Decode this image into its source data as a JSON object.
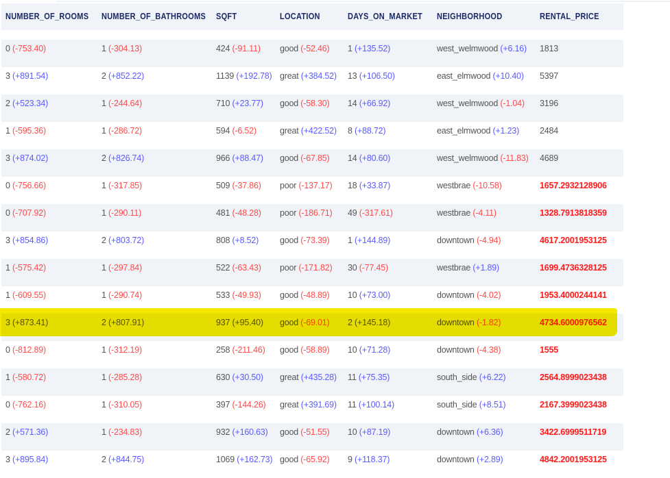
{
  "columns": [
    "NUMBER_OF_ROOMS",
    "NUMBER_OF_BATHROOMS",
    "SQFT",
    "LOCATION",
    "DAYS_ON_MARKET",
    "NEIGHBORHOOD",
    "RENTAL_PRICE"
  ],
  "colors": {
    "negative": "#ff4a4a",
    "positive": "#5b5bff",
    "price_highlight": "#ff1a1a",
    "header": "#1b2a66",
    "row_highlight": "#f5e800"
  },
  "highlighted_row": 10,
  "rows": [
    {
      "cells": [
        [
          "0",
          "(-753.40)"
        ],
        [
          "1",
          "(-304.13)"
        ],
        [
          "424",
          "(-91.11)"
        ],
        [
          "good",
          "(-52.46)"
        ],
        [
          "1",
          "(+135.52)"
        ],
        [
          "west_welmwood",
          "(+6.16)"
        ]
      ],
      "price": "1813",
      "price_bold": false
    },
    {
      "cells": [
        [
          "3",
          "(+891.54)"
        ],
        [
          "2",
          "(+852.22)"
        ],
        [
          "1139",
          "(+192.78)"
        ],
        [
          "great",
          "(+384.52)"
        ],
        [
          "13",
          "(+106.50)"
        ],
        [
          "east_elmwood",
          "(+10.40)"
        ]
      ],
      "price": "5397",
      "price_bold": false
    },
    {
      "cells": [
        [
          "2",
          "(+523.34)"
        ],
        [
          "1",
          "(-244.64)"
        ],
        [
          "710",
          "(+23.77)"
        ],
        [
          "good",
          "(-58.30)"
        ],
        [
          "14",
          "(+66.92)"
        ],
        [
          "west_welmwood",
          "(-1.04)"
        ]
      ],
      "price": "3196",
      "price_bold": false
    },
    {
      "cells": [
        [
          "1",
          "(-595.36)"
        ],
        [
          "1",
          "(-286.72)"
        ],
        [
          "594",
          "(-6.52)"
        ],
        [
          "great",
          "(+422.52)"
        ],
        [
          "8",
          "(+88.72)"
        ],
        [
          "east_elmwood",
          "(+1.23)"
        ]
      ],
      "price": "2484",
      "price_bold": false
    },
    {
      "cells": [
        [
          "3",
          "(+874.02)"
        ],
        [
          "2",
          "(+826.74)"
        ],
        [
          "966",
          "(+88.47)"
        ],
        [
          "good",
          "(-67.85)"
        ],
        [
          "14",
          "(+80.60)"
        ],
        [
          "west_welmwood",
          "(-11.83)"
        ]
      ],
      "price": "4689",
      "price_bold": false
    },
    {
      "cells": [
        [
          "0",
          "(-756.66)"
        ],
        [
          "1",
          "(-317.85)"
        ],
        [
          "509",
          "(-37.86)"
        ],
        [
          "poor",
          "(-137.17)"
        ],
        [
          "18",
          "(+33.87)"
        ],
        [
          "westbrae",
          "(-10.58)"
        ]
      ],
      "price": "1657.2932128906",
      "price_bold": true
    },
    {
      "cells": [
        [
          "0",
          "(-707.92)"
        ],
        [
          "1",
          "(-290.11)"
        ],
        [
          "481",
          "(-48.28)"
        ],
        [
          "poor",
          "(-186.71)"
        ],
        [
          "49",
          "(-317.61)"
        ],
        [
          "westbrae",
          "(-4.11)"
        ]
      ],
      "price": "1328.7913818359",
      "price_bold": true
    },
    {
      "cells": [
        [
          "3",
          "(+854.86)"
        ],
        [
          "2",
          "(+803.72)"
        ],
        [
          "808",
          "(+8.52)"
        ],
        [
          "good",
          "(-73.39)"
        ],
        [
          "1",
          "(+144.89)"
        ],
        [
          "downtown",
          "(-4.94)"
        ]
      ],
      "price": "4617.2001953125",
      "price_bold": true
    },
    {
      "cells": [
        [
          "1",
          "(-575.42)"
        ],
        [
          "1",
          "(-297.84)"
        ],
        [
          "522",
          "(-63.43)"
        ],
        [
          "poor",
          "(-171.82)"
        ],
        [
          "30",
          "(-77.45)"
        ],
        [
          "westbrae",
          "(+1.89)"
        ]
      ],
      "price": "1699.4736328125",
      "price_bold": true
    },
    {
      "cells": [
        [
          "1",
          "(-609.55)"
        ],
        [
          "1",
          "(-290.74)"
        ],
        [
          "533",
          "(-49.93)"
        ],
        [
          "good",
          "(-48.89)"
        ],
        [
          "10",
          "(+73.00)"
        ],
        [
          "downtown",
          "(-4.02)"
        ]
      ],
      "price": "1953.4000244141",
      "price_bold": true
    },
    {
      "cells": [
        [
          "3",
          "(+873.41)"
        ],
        [
          "2",
          "(+807.91)"
        ],
        [
          "937",
          "(+95.40)"
        ],
        [
          "good",
          "(-69.01)"
        ],
        [
          "2",
          "(+145.18)"
        ],
        [
          "downtown",
          "(-1.82)"
        ]
      ],
      "price": "4734.6000976562",
      "price_bold": true
    },
    {
      "cells": [
        [
          "0",
          "(-812.89)"
        ],
        [
          "1",
          "(-312.19)"
        ],
        [
          "258",
          "(-211.46)"
        ],
        [
          "good",
          "(-58.89)"
        ],
        [
          "10",
          "(+71.28)"
        ],
        [
          "downtown",
          "(-4.38)"
        ]
      ],
      "price": "1555",
      "price_bold": true
    },
    {
      "cells": [
        [
          "1",
          "(-580.72)"
        ],
        [
          "1",
          "(-285.28)"
        ],
        [
          "630",
          "(+30.50)"
        ],
        [
          "great",
          "(+435.28)"
        ],
        [
          "11",
          "(+75.35)"
        ],
        [
          "south_side",
          "(+6.22)"
        ]
      ],
      "price": "2564.8999023438",
      "price_bold": true
    },
    {
      "cells": [
        [
          "0",
          "(-762.16)"
        ],
        [
          "1",
          "(-310.05)"
        ],
        [
          "397",
          "(-144.26)"
        ],
        [
          "great",
          "(+391.69)"
        ],
        [
          "11",
          "(+100.14)"
        ],
        [
          "south_side",
          "(+8.51)"
        ]
      ],
      "price": "2167.3999023438",
      "price_bold": true
    },
    {
      "cells": [
        [
          "2",
          "(+571.36)"
        ],
        [
          "1",
          "(-234.83)"
        ],
        [
          "932",
          "(+160.63)"
        ],
        [
          "good",
          "(-51.55)"
        ],
        [
          "10",
          "(+87.19)"
        ],
        [
          "downtown",
          "(+6.36)"
        ]
      ],
      "price": "3422.6999511719",
      "price_bold": true
    },
    {
      "cells": [
        [
          "3",
          "(+895.84)"
        ],
        [
          "2",
          "(+844.75)"
        ],
        [
          "1069",
          "(+162.73)"
        ],
        [
          "good",
          "(-65.92)"
        ],
        [
          "9",
          "(+118.37)"
        ],
        [
          "downtown",
          "(+2.89)"
        ]
      ],
      "price": "4842.2001953125",
      "price_bold": true
    }
  ]
}
